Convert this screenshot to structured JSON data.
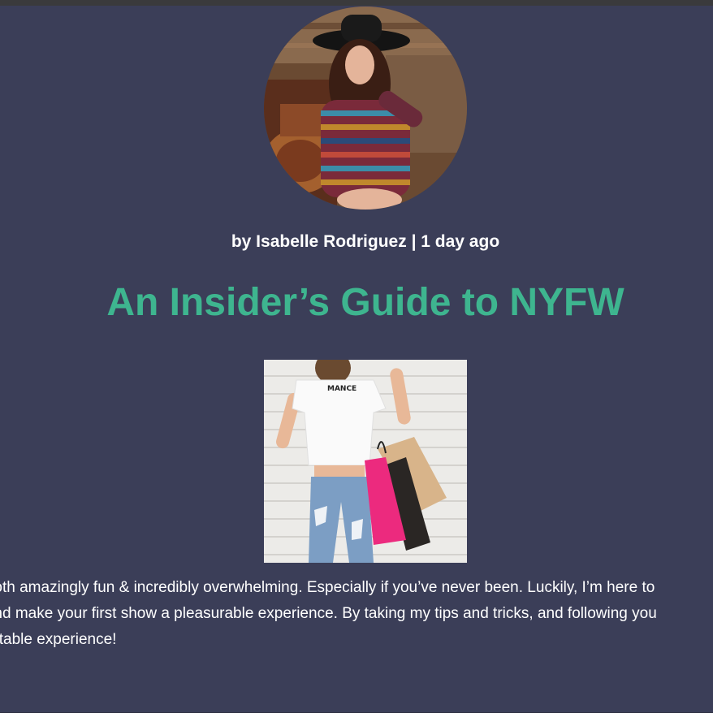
{
  "article": {
    "author_photo_alt": "author-photo",
    "byline": "by Isabelle Rodriguez | 1 day ago",
    "title": "An Insider’s Guide to NYFW",
    "hero_image": "hero-shopping-image",
    "hero_tshirt_text": "MANCE",
    "body_lines": [
      "e both amazingly fun & incredibly overwhelming. Especially if you’ve never been. Luckily, I’m here to",
      "e and make your first show a pleasurable experience. By taking my tips and tricks, and following you",
      "rgettable experience!"
    ]
  },
  "colors": {
    "background": "#3b3e58",
    "title": "#3eb58f",
    "text": "#ffffff"
  }
}
